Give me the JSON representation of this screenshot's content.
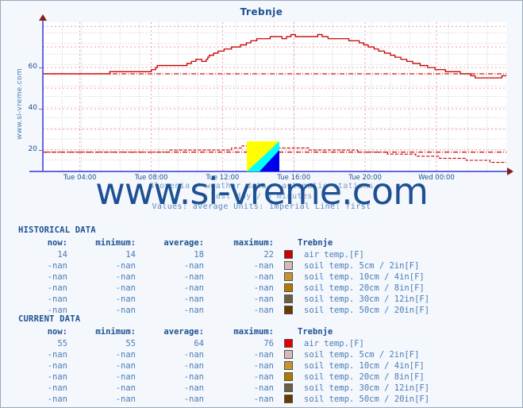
{
  "chart_data": {
    "type": "line",
    "title": "Trebnje",
    "xlabel": "",
    "ylabel": "",
    "ylim": [
      10,
      82
    ],
    "yticks": [
      20,
      40,
      60
    ],
    "grid": true,
    "legend_position": "none",
    "xtick_labels": [
      "Tue 04:00",
      "Tue 08:00",
      "Tue 12:00",
      "Tue 16:00",
      "Tue 20:00",
      "Wed 00:00"
    ],
    "captions": {
      "line1": "Slovenia / weather data - automatic stations",
      "line2": "last day / 5 minutes",
      "line3": "Values: average  Units: imperial  Line: first"
    },
    "series": [
      {
        "name": "air temp. current [F]",
        "color": "#cc0000",
        "style": "solid",
        "values": [
          57,
          57,
          57,
          57,
          57,
          57,
          57,
          57,
          57,
          57,
          57,
          57,
          57,
          57,
          57,
          57,
          57,
          57,
          57,
          57,
          57,
          57,
          57,
          57,
          57,
          57,
          57,
          57,
          57,
          57,
          57,
          57,
          57,
          57,
          57,
          57,
          57,
          57,
          57,
          57,
          57,
          57,
          57,
          57,
          57,
          58,
          58,
          58,
          58,
          58,
          58,
          58,
          58,
          58,
          58,
          58,
          58,
          58,
          58,
          58,
          58,
          58,
          58,
          58,
          58,
          58,
          58,
          58,
          58,
          58,
          58,
          58,
          58,
          59,
          59,
          59,
          60,
          61,
          61,
          61,
          61,
          61,
          61,
          61,
          61,
          61,
          61,
          61,
          61,
          61,
          61,
          61,
          61,
          61,
          61,
          61,
          61,
          62,
          62,
          62,
          63,
          63,
          63,
          64,
          64,
          64,
          64,
          63,
          63,
          63,
          64,
          65,
          66,
          66,
          66,
          67,
          67,
          67,
          68,
          68,
          68,
          68,
          69,
          69,
          69,
          69,
          69,
          70,
          70,
          70,
          70,
          70,
          70,
          71,
          71,
          71,
          71,
          72,
          72,
          72,
          73,
          73,
          73,
          73,
          74,
          74,
          74,
          74,
          74,
          74,
          74,
          74,
          74,
          75,
          75,
          75,
          75,
          75,
          75,
          75,
          75,
          74,
          74,
          74,
          75,
          75,
          75,
          76,
          76,
          76,
          75,
          75,
          75,
          75,
          75,
          75,
          75,
          75,
          75,
          75,
          75,
          75,
          75,
          75,
          75,
          76,
          76,
          76,
          75,
          75,
          75,
          75,
          74,
          74,
          74,
          74,
          74,
          74,
          74,
          74,
          74,
          74,
          74,
          74,
          74,
          74,
          73,
          73,
          73,
          73,
          73,
          73,
          73,
          72,
          72,
          72,
          71,
          71,
          71,
          70,
          70,
          70,
          70,
          69,
          69,
          69,
          68,
          68,
          68,
          68,
          67,
          67,
          67,
          67,
          66,
          66,
          66,
          65,
          65,
          65,
          65,
          64,
          64,
          64,
          64,
          63,
          63,
          63,
          63,
          62,
          62,
          62,
          62,
          62,
          61,
          61,
          61,
          61,
          61,
          60,
          60,
          60,
          60,
          60,
          59,
          59,
          59,
          59,
          59,
          59,
          59,
          58,
          58,
          58,
          58,
          58,
          58,
          58,
          58,
          58,
          58,
          57,
          57,
          57,
          57,
          57,
          57,
          57,
          56,
          56,
          56,
          55,
          55,
          55,
          55,
          55,
          55,
          55,
          55,
          55,
          55,
          55,
          55,
          55,
          55,
          55,
          55,
          55,
          55,
          56,
          56,
          56,
          56
        ]
      },
      {
        "name": "air temp. historical [F]",
        "color": "#cc0000",
        "style": "dashed",
        "values": [
          19,
          19,
          19,
          19,
          19,
          19,
          19,
          19,
          19,
          19,
          19,
          19,
          19,
          19,
          19,
          19,
          19,
          19,
          19,
          19,
          19,
          19,
          19,
          19,
          19,
          19,
          19,
          19,
          19,
          19,
          19,
          19,
          19,
          19,
          19,
          19,
          19,
          19,
          19,
          19,
          19,
          19,
          19,
          19,
          19,
          19,
          19,
          19,
          19,
          19,
          19,
          19,
          19,
          19,
          19,
          19,
          19,
          19,
          19,
          19,
          19,
          19,
          19,
          19,
          19,
          19,
          19,
          19,
          19,
          19,
          19,
          19,
          19,
          19,
          19,
          19,
          19,
          19,
          19,
          19,
          19,
          19,
          19,
          19,
          19,
          20,
          20,
          20,
          20,
          20,
          20,
          20,
          20,
          20,
          20,
          20,
          20,
          20,
          20,
          20,
          20,
          20,
          20,
          20,
          20,
          20,
          20,
          20,
          20,
          20,
          20,
          20,
          20,
          20,
          20,
          20,
          20,
          20,
          20,
          20,
          20,
          20,
          20,
          20,
          20,
          20,
          20,
          21,
          21,
          21,
          21,
          21,
          21,
          21,
          22,
          22,
          22,
          22,
          22,
          22,
          22,
          22,
          22,
          21,
          21,
          21,
          21,
          21,
          21,
          21,
          21,
          21,
          21,
          21,
          21,
          21,
          21,
          21,
          21,
          21,
          21,
          21,
          21,
          21,
          21,
          21,
          21,
          21,
          21,
          21,
          21,
          21,
          21,
          21,
          21,
          21,
          21,
          21,
          21,
          20,
          20,
          20,
          20,
          20,
          20,
          20,
          20,
          20,
          20,
          20,
          20,
          20,
          20,
          20,
          20,
          20,
          20,
          20,
          20,
          20,
          20,
          20,
          20,
          20,
          20,
          20,
          20,
          20,
          20,
          20,
          20,
          20,
          19,
          19,
          19,
          19,
          19,
          19,
          19,
          19,
          19,
          19,
          19,
          19,
          19,
          19,
          19,
          19,
          19,
          19,
          19,
          19,
          18,
          18,
          18,
          18,
          18,
          18,
          18,
          18,
          18,
          18,
          18,
          18,
          18,
          18,
          18,
          18,
          18,
          18,
          18,
          17,
          17,
          17,
          17,
          17,
          17,
          17,
          17,
          17,
          17,
          17,
          17,
          17,
          17,
          17,
          17,
          16,
          16,
          16,
          16,
          16,
          16,
          16,
          16,
          16,
          16,
          16,
          16,
          16,
          16,
          16,
          16,
          16,
          16,
          15,
          15,
          15,
          15,
          15,
          15,
          15,
          15,
          15,
          15,
          15,
          15,
          15,
          15,
          15,
          15,
          14,
          14,
          14,
          14,
          14,
          14,
          14,
          14,
          14,
          14,
          14,
          14
        ]
      },
      {
        "name": "reference line current",
        "color": "#cc0000",
        "style": "dashdot",
        "constant": 57
      },
      {
        "name": "reference line historical",
        "color": "#cc0000",
        "style": "dashdot",
        "constant": 19
      }
    ]
  },
  "side_watermark": "www.si-vreme.com",
  "watermark": "www.si-vreme.com",
  "historical": {
    "block_title": "HISTORICAL DATA",
    "headers": {
      "now": "now:",
      "minimum": "minimum:",
      "average": "average:",
      "maximum": "maximum:",
      "station": "Trebnje"
    },
    "rows": [
      {
        "now": "14",
        "minimum": "14",
        "average": "18",
        "maximum": "22",
        "color": "#cc0000",
        "label": "air temp.[F]"
      },
      {
        "now": "-nan",
        "minimum": "-nan",
        "average": "-nan",
        "maximum": "-nan",
        "color": "#d8b8b8",
        "label": "soil temp. 5cm / 2in[F]"
      },
      {
        "now": "-nan",
        "minimum": "-nan",
        "average": "-nan",
        "maximum": "-nan",
        "color": "#c8922c",
        "label": "soil temp. 10cm / 4in[F]"
      },
      {
        "now": "-nan",
        "minimum": "-nan",
        "average": "-nan",
        "maximum": "-nan",
        "color": "#b07800",
        "label": "soil temp. 20cm / 8in[F]"
      },
      {
        "now": "-nan",
        "minimum": "-nan",
        "average": "-nan",
        "maximum": "-nan",
        "color": "#6b6040",
        "label": "soil temp. 30cm / 12in[F]"
      },
      {
        "now": "-nan",
        "minimum": "-nan",
        "average": "-nan",
        "maximum": "-nan",
        "color": "#6b3800",
        "label": "soil temp. 50cm / 20in[F]"
      }
    ]
  },
  "current": {
    "block_title": "CURRENT DATA",
    "headers": {
      "now": "now:",
      "minimum": "minimum:",
      "average": "average:",
      "maximum": "maximum:",
      "station": "Trebnje"
    },
    "rows": [
      {
        "now": "55",
        "minimum": "55",
        "average": "64",
        "maximum": "76",
        "color": "#e60000",
        "label": "air temp.[F]"
      },
      {
        "now": "-nan",
        "minimum": "-nan",
        "average": "-nan",
        "maximum": "-nan",
        "color": "#d8b8b8",
        "label": "soil temp. 5cm / 2in[F]"
      },
      {
        "now": "-nan",
        "minimum": "-nan",
        "average": "-nan",
        "maximum": "-nan",
        "color": "#c8922c",
        "label": "soil temp. 10cm / 4in[F]"
      },
      {
        "now": "-nan",
        "minimum": "-nan",
        "average": "-nan",
        "maximum": "-nan",
        "color": "#b07800",
        "label": "soil temp. 20cm / 8in[F]"
      },
      {
        "now": "-nan",
        "minimum": "-nan",
        "average": "-nan",
        "maximum": "-nan",
        "color": "#6b6040",
        "label": "soil temp. 30cm / 12in[F]"
      },
      {
        "now": "-nan",
        "minimum": "-nan",
        "average": "-nan",
        "maximum": "-nan",
        "color": "#6b3800",
        "label": "soil temp. 50cm / 20in[F]"
      }
    ]
  }
}
